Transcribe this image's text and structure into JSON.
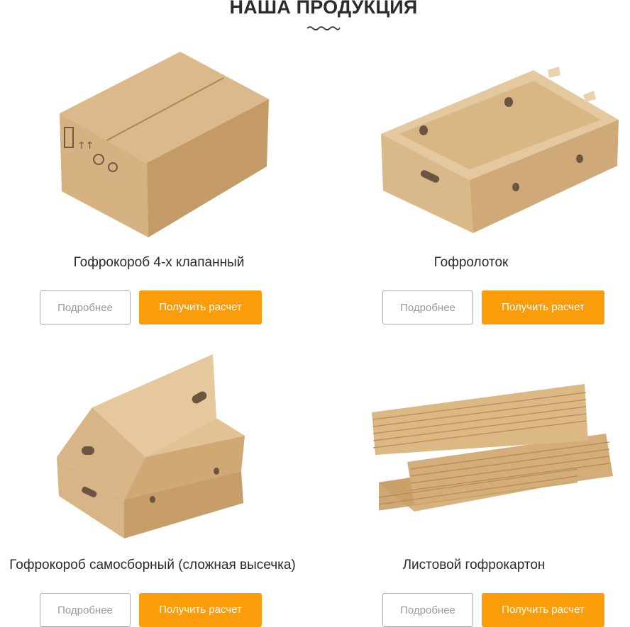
{
  "section": {
    "title": "НАША ПРОДУКЦИЯ"
  },
  "products": [
    {
      "name": "Гофрокороб 4-х клапанный",
      "more_label": "Подробнее",
      "calc_label": "Получить расчет",
      "image_icon": "box-four-flap-icon"
    },
    {
      "name": "Гофролоток",
      "more_label": "Подробнее",
      "calc_label": "Получить расчет",
      "image_icon": "tray-icon"
    },
    {
      "name": "Гофрокороб самосборный (сложная высечка)",
      "more_label": "Подробнее",
      "calc_label": "Получить расчет",
      "image_icon": "self-assembly-box-icon"
    },
    {
      "name": "Листовой гофрокартон",
      "more_label": "Подробнее",
      "calc_label": "Получить расчет",
      "image_icon": "sheets-icon"
    }
  ],
  "colors": {
    "accent": "#fb9d0a",
    "cardboard_light": "#e2c49a",
    "cardboard_mid": "#d3ae7d",
    "cardboard_dark": "#b98d5a",
    "text": "#2b2b2b",
    "muted": "#9a9a9a"
  }
}
